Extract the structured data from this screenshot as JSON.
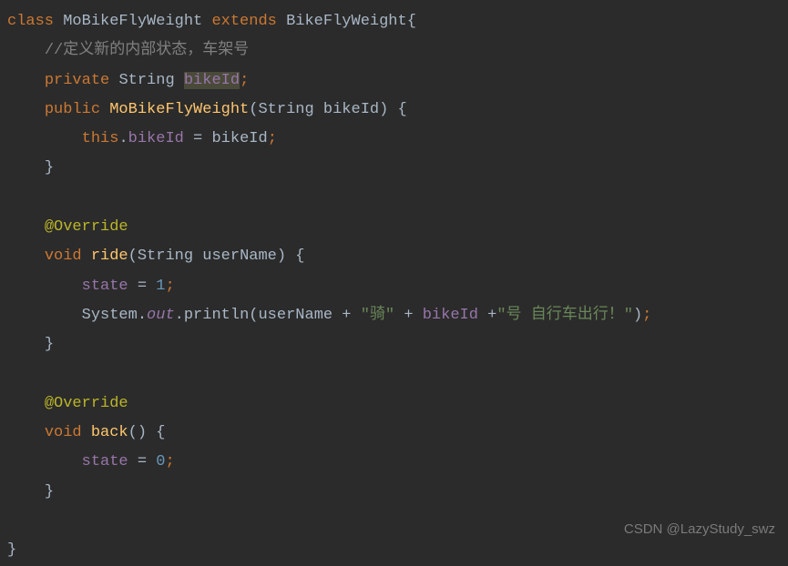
{
  "code": {
    "line1": {
      "kw_class": "class",
      "classname": "MoBikeFlyWeight",
      "kw_extends": "extends",
      "superclass": "BikeFlyWeight",
      "brace_open": "{"
    },
    "line2": {
      "comment": "//定义新的内部状态，车架号"
    },
    "line3": {
      "kw_private": "private",
      "type": "String",
      "field": "bikeId",
      "semi": ";"
    },
    "line4": {
      "kw_public": "public",
      "constructor": "MoBikeFlyWeight",
      "paren_open": "(",
      "param_type": "String",
      "param_name": "bikeId",
      "paren_close": ")",
      "brace_open": "{"
    },
    "line5": {
      "kw_this": "this",
      "dot": ".",
      "field": "bikeId",
      "eq": " = ",
      "param": "bikeId",
      "semi": ";"
    },
    "line6": {
      "brace_close": "}"
    },
    "line8": {
      "annotation": "@Override"
    },
    "line9": {
      "kw_void": "void",
      "method": "ride",
      "paren_open": "(",
      "param_type": "String",
      "param_name": "userName",
      "paren_close": ")",
      "brace_open": "{"
    },
    "line10": {
      "field": "state",
      "eq": " = ",
      "value": "1",
      "semi": ";"
    },
    "line11": {
      "sys": "System",
      "dot1": ".",
      "out": "out",
      "dot2": ".",
      "println": "println",
      "paren_open": "(",
      "arg1": "userName",
      "plus1": " + ",
      "str1": "\"骑\"",
      "plus2": " + ",
      "arg2": "bikeId",
      "plus3": " +",
      "str2": "\"号 自行车出行！\"",
      "paren_close": ")",
      "semi": ";"
    },
    "line12": {
      "brace_close": "}"
    },
    "line14": {
      "annotation": "@Override"
    },
    "line15": {
      "kw_void": "void",
      "method": "back",
      "paren_open": "(",
      "paren_close": ")",
      "brace_open": "{"
    },
    "line16": {
      "field": "state",
      "eq": " = ",
      "value": "0",
      "semi": ";"
    },
    "line17": {
      "brace_close": "}"
    },
    "line19": {
      "brace_close": "}"
    }
  },
  "watermark": "CSDN @LazyStudy_swz"
}
